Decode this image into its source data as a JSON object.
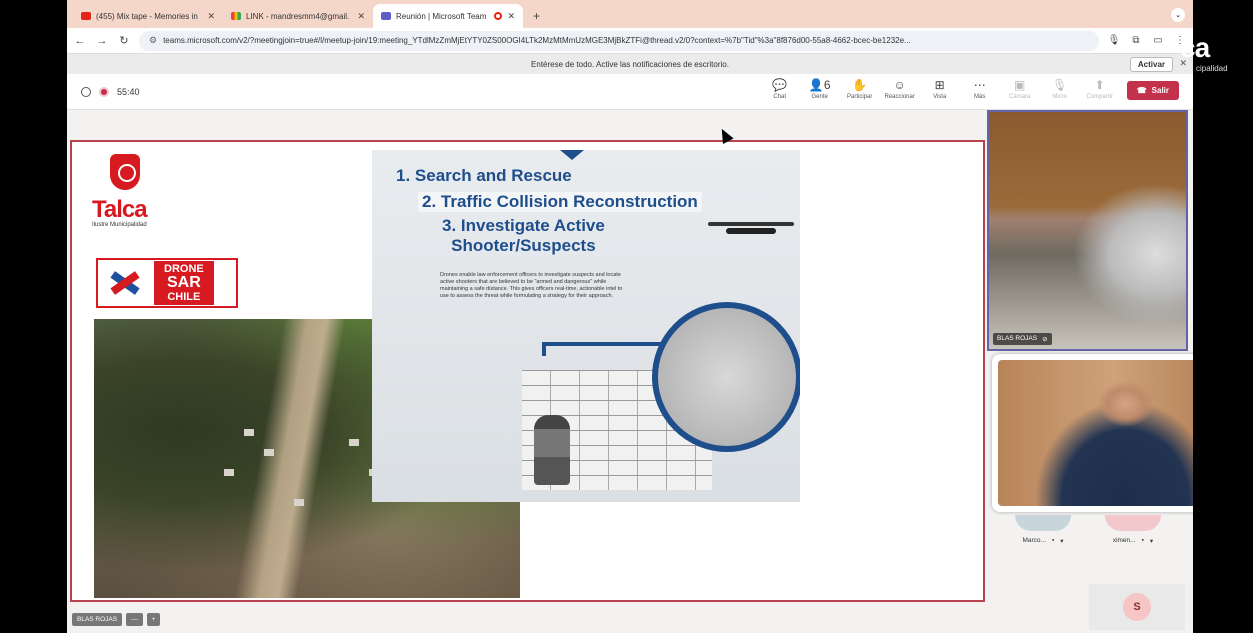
{
  "browser": {
    "tabs": [
      {
        "label": "(455) Mix tape - Memories in",
        "icon": "youtube-icon"
      },
      {
        "label": "LINK - mandresmm4@gmail.",
        "icon": "gmail-icon"
      },
      {
        "label": "Reunión | Microsoft Team",
        "icon": "teams-icon",
        "active": true
      }
    ],
    "new_tab": "+",
    "url": "teams.microsoft.com/v2/?meetingjoin=true#/l/meetup-join/19:meeting_YTdlMzZmMjEtYTY0ZS00OGI4LTk2MzMtMmUzMGE3MjBkZTFi@thread.v2/0?context=%7b\"Tid\"%3a\"8f876d00-55a8-4662-bcec-be1232e..."
  },
  "notification": {
    "text": "Entérese de todo. Active las notificaciones de escritorio.",
    "activate_label": "Activar",
    "close": "✕"
  },
  "meeting": {
    "timer": "55:40",
    "controls": [
      {
        "label": "Chat",
        "glyph": "💬",
        "enabled": true
      },
      {
        "label": "Gente",
        "glyph": "👤6",
        "enabled": true
      },
      {
        "label": "Participar",
        "glyph": "✋",
        "enabled": true
      },
      {
        "label": "Reaccionar",
        "glyph": "☺",
        "enabled": true
      },
      {
        "label": "Vista",
        "glyph": "⊞",
        "enabled": true
      },
      {
        "label": "Más",
        "glyph": "⋯",
        "enabled": true
      },
      {
        "label": "Cámara",
        "glyph": "▣",
        "enabled": false
      },
      {
        "label": "Micro",
        "glyph": "🎙",
        "enabled": false
      },
      {
        "label": "Compartir",
        "glyph": "⬆",
        "enabled": false
      }
    ],
    "leave_label": "Salir"
  },
  "slide": {
    "logo_name": "Talca",
    "logo_sub": "Ilustre Municipalidad",
    "drone_lines": [
      "DRONE",
      "SAR",
      "CHILE"
    ],
    "heading1": "1. Search and Rescue",
    "heading2": "2. Traffic Collision Reconstruction",
    "heading3": "3. Investigate Active",
    "heading3b": "Shooter/Suspects",
    "paragraph": "Drones enable law enforcement officers to investigate suspects and locate active shooters that are believed to be \"armed and dangerous\" while maintaining a safe distance. This gives officers real-time, actionable intel to use to assess the threat while formulating a strategy for their approach."
  },
  "participants": {
    "tile1_name": "BLAS ROJAS",
    "others": [
      {
        "name": "Marco..."
      },
      {
        "name": "ximen..."
      }
    ],
    "self_initial": "S"
  },
  "bottom": {
    "presenter": "BLAS ROJAS",
    "zoom_minus": "—",
    "zoom_plus": "+"
  },
  "watermark": {
    "text": "ca",
    "sub": "cipalidad"
  }
}
